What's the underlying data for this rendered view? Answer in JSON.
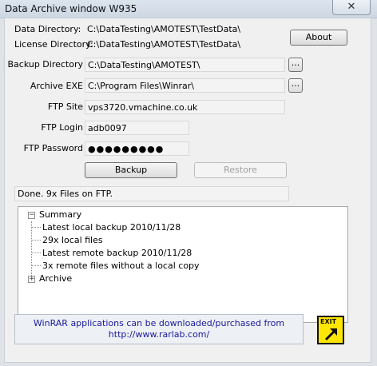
{
  "window": {
    "title": "Data Archive window W935",
    "close_glyph": "✕"
  },
  "paths": {
    "data_dir_label": "Data Directory:",
    "data_dir_value": "C:\\DataTesting\\AMOTEST\\TestData\\",
    "license_dir_label": "License Directory:",
    "license_dir_value": "C:\\DataTesting\\AMOTEST\\TestData\\"
  },
  "about_label": "About",
  "form": {
    "backup_dir_label": "Backup Directory",
    "backup_dir_value": "C:\\DataTesting\\AMOTEST\\",
    "archive_exe_label": "Archive EXE",
    "archive_exe_value": "C:\\Program Files\\Winrar\\",
    "ftp_site_label": "FTP Site",
    "ftp_site_value": "vps3720.vmachine.co.uk",
    "ftp_login_label": "FTP Login",
    "ftp_login_value": "adb0097",
    "ftp_password_label": "FTP Password",
    "ftp_password_value": "●●●●●●●●●",
    "browse_label": "..."
  },
  "actions": {
    "backup_label": "Backup",
    "restore_label": "Restore"
  },
  "status_text": "Done. 9x Files on FTP.",
  "tree": {
    "summary_label": "Summary",
    "summary_toggle": "−",
    "summary_items": [
      "Latest local backup 2010/11/28",
      "29x local files",
      "Latest remote backup 2010/11/28",
      "3x remote files without a local copy"
    ],
    "archive_label": "Archive",
    "archive_toggle": "+"
  },
  "info": {
    "line1": "WinRAR applications can be downloaded/purchased from",
    "line2": "http://www.rarlab.com/"
  },
  "exit": {
    "label": "EXIT",
    "icon": "exit-arrow-icon",
    "color": "#ffe600"
  }
}
